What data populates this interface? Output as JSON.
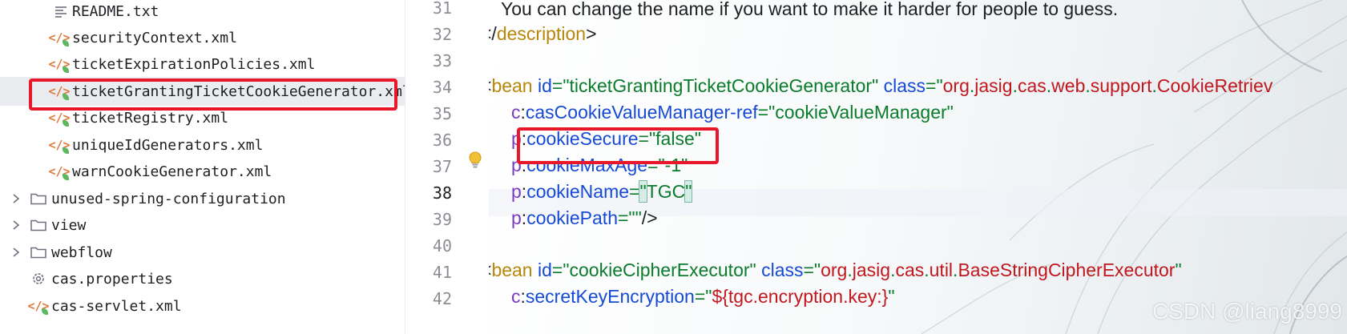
{
  "tree": {
    "items": [
      {
        "label": "README.txt",
        "icon": "text-file-icon"
      },
      {
        "label": "securityContext.xml",
        "icon": "xml-file-icon"
      },
      {
        "label": "ticketExpirationPolicies.xml",
        "icon": "xml-file-icon"
      },
      {
        "label": "ticketGrantingTicketCookieGenerator.xml",
        "icon": "xml-file-icon",
        "selected": true
      },
      {
        "label": "ticketRegistry.xml",
        "icon": "xml-file-icon"
      },
      {
        "label": "uniqueIdGenerators.xml",
        "icon": "xml-file-icon"
      },
      {
        "label": "warnCookieGenerator.xml",
        "icon": "xml-file-icon"
      },
      {
        "label": "unused-spring-configuration",
        "icon": "folder-icon",
        "expandable": true
      },
      {
        "label": "view",
        "icon": "folder-icon",
        "expandable": true
      },
      {
        "label": "webflow",
        "icon": "folder-icon",
        "expandable": true
      },
      {
        "label": "cas.properties",
        "icon": "gear-file-icon"
      },
      {
        "label": "cas-servlet.xml",
        "icon": "xml-file-icon"
      }
    ]
  },
  "editor": {
    "line_numbers": [
      "31",
      "32",
      "33",
      "34",
      "35",
      "36",
      "37",
      "38",
      "39",
      "40",
      "41",
      "42"
    ],
    "current_line": "38",
    "lines": {
      "l31": {
        "text": "You can change the name if you want to make it harder for people to guess."
      },
      "l32": {
        "open": "</",
        "tag": "description",
        "close": ">"
      },
      "l34": {
        "open": "<",
        "tag": "bean",
        "a1": "id",
        "eq1": "=\"",
        "v1": "ticketGrantingTicketCookieGenerator",
        "q1": "\"",
        "a2": "class",
        "eq2": "=\"",
        "pkg1": "org",
        "dot1": ".",
        "pkg2": "jasig",
        "dot2": ".",
        "pkg3": "cas",
        "dot3": ".",
        "pkg4": "web",
        "dot4": ".",
        "pkg5": "support",
        "dot5": ".",
        "cls": "CookieRetriev"
      },
      "l35": {
        "ns": "c",
        "colon": ":",
        "attr": "casCookieValueManager-ref",
        "eq": "=\"",
        "val": "cookieValueManager",
        "q": "\""
      },
      "l36": {
        "ns": "p",
        "colon": ":",
        "attr": "cookieSecure",
        "eq": "=\"",
        "val": "false",
        "q": "\""
      },
      "l37": {
        "ns": "p",
        "colon": ":",
        "attr": "cookieMaxAge",
        "eq": "=\"",
        "val": "-1",
        "q": "\""
      },
      "l38": {
        "ns": "p",
        "colon": ":",
        "attr": "cookieName",
        "eq": "=",
        "q_open": "\"",
        "val": "TGC",
        "q_close": "\""
      },
      "l39": {
        "ns": "p",
        "colon": ":",
        "attr": "cookiePath",
        "eq": "=\"\"",
        "close": "/>"
      },
      "l41": {
        "open": "<",
        "tag": "bean",
        "a1": "id",
        "eq1": "=\"",
        "v1": "cookieCipherExecutor",
        "q1": "\"",
        "a2": "class",
        "eq2": "=\"",
        "pkg1": "org",
        "dot1": ".",
        "pkg2": "jasig",
        "dot2": ".",
        "pkg3": "cas",
        "dot3": ".",
        "pkg4": "util",
        "dot4": ".",
        "cls": "BaseStringCipherExecutor",
        "q2": "\""
      },
      "l42": {
        "ns": "c",
        "colon": ":",
        "attr": "secretKeyEncryption",
        "eq": "=\"",
        "val": "${tgc.encryption.key:}",
        "q": "\""
      }
    }
  },
  "watermark": "CSDN @liang8999",
  "colors": {
    "highlight_border": "#e8182a",
    "xml_icon": "#e07a3a",
    "attr": "#174ad4",
    "value": "#0a7c2c",
    "namespace": "#7a3bc2",
    "package": "#c0181e"
  }
}
